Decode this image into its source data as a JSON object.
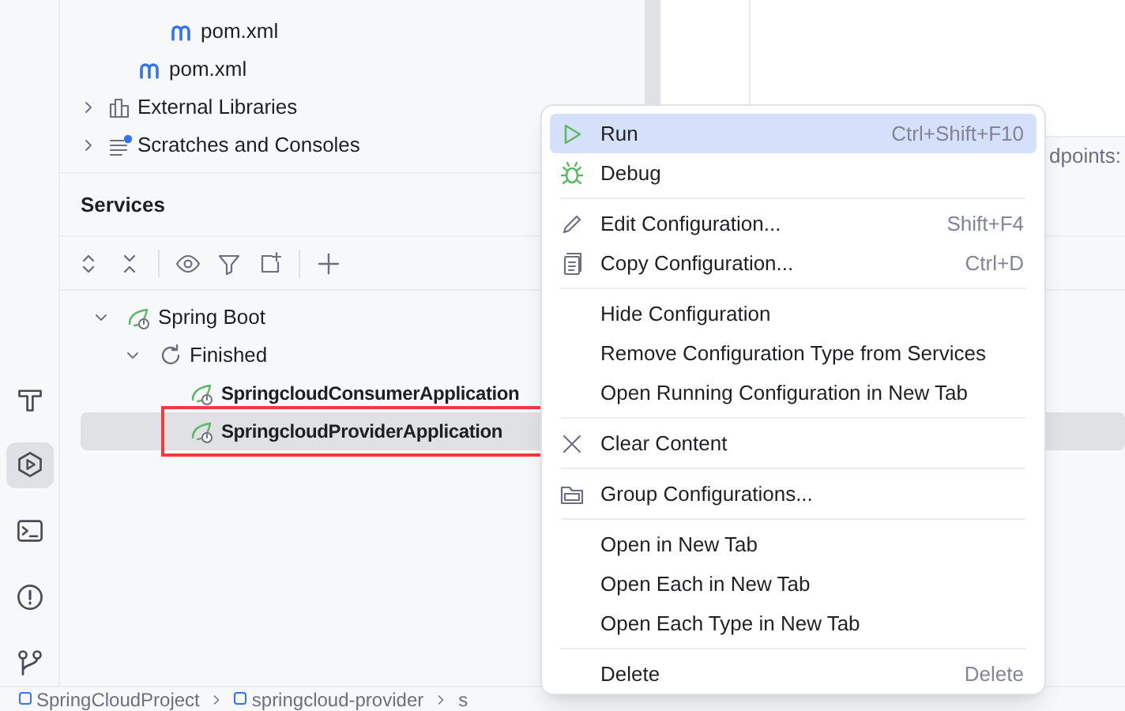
{
  "project_tree": [
    {
      "children": [
        {
          "label": "pom.xml"
        }
      ]
    },
    {
      "label": "pom.xml"
    },
    {
      "label": "External Libraries",
      "expanded": false
    },
    {
      "label": "Scratches and Consoles",
      "expanded": false
    }
  ],
  "services": {
    "title": "Services",
    "tree": [
      {
        "label": "Spring Boot",
        "expanded": true,
        "selected": false,
        "children": [
          {
            "label": "Finished",
            "expanded": true,
            "selected": false,
            "children": [
              {
                "label": "SpringcloudConsumerApplication",
                "selected": false
              },
              {
                "label": "SpringcloudProviderApplication",
                "selected": true
              }
            ]
          }
        ]
      }
    ]
  },
  "editor": {
    "text": "dpoints:"
  },
  "context_menu": {
    "groups": [
      [
        {
          "label": "Run",
          "shortcut": "Ctrl+Shift+F10",
          "selected": true
        },
        {
          "label": "Debug",
          "selected": false
        }
      ],
      [
        {
          "label": "Edit Configuration...",
          "shortcut": "Shift+F4",
          "selected": false
        },
        {
          "label": "Copy Configuration...",
          "shortcut": "Ctrl+D",
          "selected": false
        }
      ],
      [
        {
          "label": "Hide Configuration",
          "selected": false
        },
        {
          "label": "Remove Configuration Type from Services",
          "selected": false
        },
        {
          "label": "Open Running Configuration in New Tab",
          "selected": false
        }
      ],
      [
        {
          "label": "Clear Content",
          "selected": false
        }
      ],
      [
        {
          "label": "Group Configurations...",
          "selected": false
        }
      ],
      [
        {
          "label": "Open in New Tab",
          "selected": false
        },
        {
          "label": "Open Each in New Tab",
          "selected": false
        },
        {
          "label": "Open Each Type in New Tab",
          "selected": false
        }
      ],
      [
        {
          "label": "Delete",
          "shortcut": "Delete",
          "selected": false
        }
      ]
    ]
  },
  "breadcrumbs": [
    "SpringCloudProject",
    "springcloud-provider",
    "s"
  ]
}
